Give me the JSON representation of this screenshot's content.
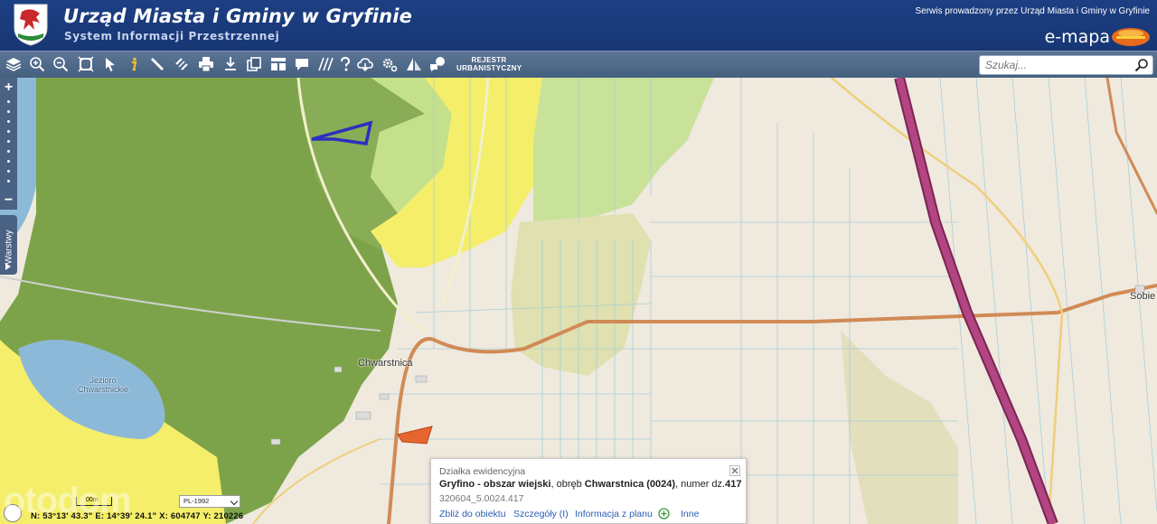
{
  "header": {
    "title": "Urząd Miasta i Gminy w Gryfinie",
    "subtitle": "System Informacji Przestrzennej",
    "service_text": "Serwis prowadzony przez Urząd Miasta i Gminy w Gryfinie",
    "brand": "e-mapa"
  },
  "toolbar": {
    "tools": [
      "layers-icon",
      "zoom-in-icon",
      "zoom-out-icon",
      "zoom-extent-icon",
      "pointer-icon",
      "info-icon",
      "measure-icon",
      "link-icon",
      "print-icon",
      "download-icon",
      "copy-icon",
      "layout-icon",
      "comment-icon",
      "hatch-icon",
      "help-icon",
      "cloud-icon",
      "settings-icon",
      "terrain-icon",
      "chat-icon"
    ],
    "rejestr_line1": "REJESTR",
    "rejestr_line2": "URBANISTYCZNY",
    "search_placeholder": "Szukaj..."
  },
  "map": {
    "layers_tab": "Warstwy",
    "labels": {
      "village": "Chwarstnica",
      "lake_line1": "Jezioro",
      "lake_line2": "Chwarstnickie",
      "edge_town": "Sobie"
    },
    "colors": {
      "forest": "#7da34a",
      "forest_light": "#a9cd6e",
      "meadow": "#d6e8a6",
      "yellow_zone": "#f4ee6a",
      "water": "#8db9d9",
      "expressway": "#9e2f6a",
      "main_road": "#d18a55",
      "parcel_outline": "#2c2fbf",
      "selected_parcel": "#e4662e"
    }
  },
  "popup": {
    "title": "Działka ewidencyjna",
    "place_bold": "Gryfino - obszar wiejski",
    "text_obreb": ", obręb ",
    "obreb_bold": "Chwarstnica (0024)",
    "text_numer": ", numer dz.",
    "numer_bold": "417",
    "parcel_id": "320604_5.0024.417",
    "link_zoom": "Zbliż do obiektu",
    "link_details": "Szczegóły (I)",
    "link_plan": "Informacja z planu",
    "link_other": "Inne"
  },
  "statusbar": {
    "scale_label": "00m",
    "crs": "PL-1992",
    "coords": "N: 53°13' 43.3\"  E: 14°39' 24.1\"  X: 604747   Y: 210226"
  },
  "watermark": "otodom"
}
